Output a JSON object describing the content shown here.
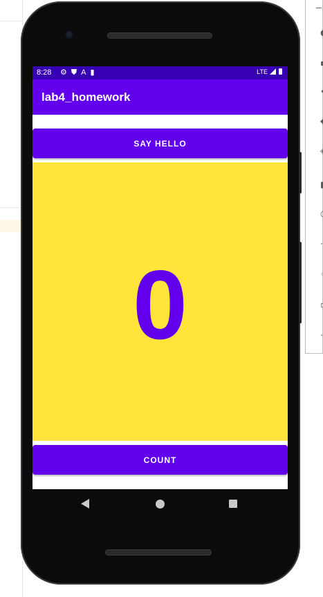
{
  "status_bar": {
    "time": "8:28",
    "icons": [
      "gear-icon",
      "shield-icon",
      "font-icon",
      "sd-card-icon"
    ],
    "network": "LTE"
  },
  "app": {
    "title": "lab4_homework",
    "say_hello_label": "SAY HELLO",
    "count_label": "COUNT",
    "count_value": "0"
  },
  "navigation": {
    "back": "back-icon",
    "home": "home-icon",
    "recents": "recents-icon"
  },
  "colors": {
    "status_bar": "#3700b3",
    "primary": "#6200ee",
    "count_background": "#ffe43b",
    "count_text": "#6200ee"
  }
}
